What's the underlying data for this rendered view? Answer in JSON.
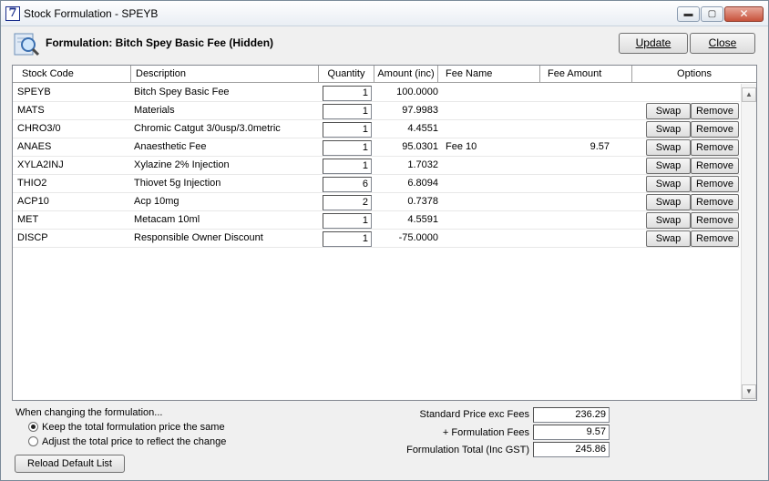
{
  "window": {
    "title": "Stock Formulation - SPEYB",
    "app_icon_glyph": "7",
    "minimize_glyph": "▬",
    "maximize_glyph": "▢",
    "close_glyph": "✕"
  },
  "header": {
    "title": "Formulation: Bitch Spey Basic Fee (Hidden)",
    "icon": "magnifier-document-icon",
    "update_label": "Update",
    "close_label": "Close"
  },
  "grid": {
    "columns": [
      "Stock Code",
      "Description",
      "Quantity",
      "Amount (inc)",
      "Fee Name",
      "Fee Amount",
      "Options"
    ],
    "swap_label": "Swap",
    "remove_label": "Remove",
    "scroll_up_glyph": "▲",
    "scroll_down_glyph": "▼",
    "rows": [
      {
        "code": "SPEYB",
        "description": "Bitch Spey Basic Fee",
        "quantity": "1",
        "amount": "100.0000",
        "fee_name": "",
        "fee_amount": "",
        "has_options": false
      },
      {
        "code": "MATS",
        "description": "Materials",
        "quantity": "1",
        "amount": "97.9983",
        "fee_name": "",
        "fee_amount": "",
        "has_options": true
      },
      {
        "code": "CHRO3/0",
        "description": "Chromic Catgut 3/0usp/3.0metric",
        "quantity": "1",
        "amount": "4.4551",
        "fee_name": "",
        "fee_amount": "",
        "has_options": true
      },
      {
        "code": "ANAES",
        "description": "Anaesthetic Fee",
        "quantity": "1",
        "amount": "95.0301",
        "fee_name": "Fee 10",
        "fee_amount": "9.57",
        "has_options": true
      },
      {
        "code": "XYLA2INJ",
        "description": "Xylazine 2% Injection",
        "quantity": "1",
        "amount": "1.7032",
        "fee_name": "",
        "fee_amount": "",
        "has_options": true
      },
      {
        "code": "THIO2",
        "description": "Thiovet 5g Injection",
        "quantity": "6",
        "amount": "6.8094",
        "fee_name": "",
        "fee_amount": "",
        "has_options": true
      },
      {
        "code": "ACP10",
        "description": "Acp 10mg",
        "quantity": "2",
        "amount": "0.7378",
        "fee_name": "",
        "fee_amount": "",
        "has_options": true
      },
      {
        "code": "MET",
        "description": "Metacam 10ml",
        "quantity": "1",
        "amount": "4.5591",
        "fee_name": "",
        "fee_amount": "",
        "has_options": true
      },
      {
        "code": "DISCP",
        "description": "Responsible Owner Discount",
        "quantity": "1",
        "amount": "-75.0000",
        "fee_name": "",
        "fee_amount": "",
        "has_options": true
      }
    ]
  },
  "options": {
    "heading": "When changing the formulation...",
    "keep_label": "Keep the total formulation price the same",
    "adjust_label": "Adjust the total price to reflect the change",
    "selected": "keep",
    "reload_label": "Reload Default List"
  },
  "summary": {
    "standard_label": "Standard Price exc Fees",
    "standard_value": "236.29",
    "fees_label": "+ Formulation Fees",
    "fees_value": "9.57",
    "total_label": "Formulation Total (Inc GST)",
    "total_value": "245.86"
  }
}
